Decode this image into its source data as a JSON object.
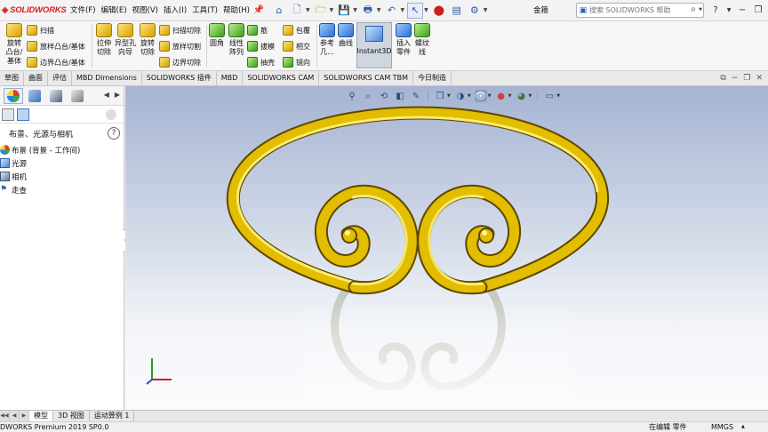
{
  "app": {
    "logo_brand": "SOLIDWORKS",
    "document_title": "金箍",
    "version_text": "DWORKS Premium 2019 SP0.0"
  },
  "menu": {
    "items": [
      "文件(F)",
      "编辑(E)",
      "视图(V)",
      "插入(I)",
      "工具(T)",
      "帮助(H)"
    ]
  },
  "search": {
    "placeholder": "搜索 SOLIDWORKS 帮助"
  },
  "ribbon": {
    "revolve_boss": "旋转\n凸台/\n基体",
    "sweep": "扫描",
    "loft_boss": "放样凸台/基体",
    "boundary_boss": "边界凸台/基体",
    "extrude_cut": "拉伸\n切除",
    "hole_wizard": "异型孔\n向导",
    "revolve_cut": "旋转\n切除",
    "swept_cut": "扫描切除",
    "lofted_cut": "放样切割",
    "boundary_cut": "边界切除",
    "fillet": "圆角",
    "linear_pattern": "线性\n阵列",
    "rib": "筋",
    "draft": "拔模",
    "shell": "抽壳",
    "wrap": "包覆",
    "intersect": "相交",
    "mirror": "镜向",
    "ref_geometry": "参考\n几...",
    "curves": "曲线",
    "instant3d": "Instant3D",
    "insert_part": "插入\n零件",
    "thread": "螺纹\n线"
  },
  "cm_tabs": [
    "草图",
    "曲面",
    "评估",
    "MBD Dimensions",
    "SOLIDWORKS 插件",
    "MBD",
    "SOLIDWORKS CAM",
    "SOLIDWORKS CAM TBM",
    "今日制造"
  ],
  "panel": {
    "header": "布景、光源与相机",
    "tree": [
      {
        "label": "布景 (背景 - 工作间)",
        "icon": "scene-icon"
      },
      {
        "label": "光源",
        "icon": "light-icon"
      },
      {
        "label": "相机",
        "icon": "camera-icon"
      },
      {
        "label": "走查",
        "icon": "walkthrough-icon"
      }
    ]
  },
  "model_tabs": [
    "模型",
    "3D 视图",
    "运动算例 1"
  ],
  "status": {
    "mode": "在编辑 零件",
    "units": "MMGS"
  },
  "colors": {
    "gold_light": "#fff27a",
    "gold_mid": "#e8c200",
    "gold_dark": "#6b4f00",
    "viewport_top": "#a6b4d2",
    "viewport_bottom": "#fafbfc",
    "logo_red": "#d81e1e"
  }
}
